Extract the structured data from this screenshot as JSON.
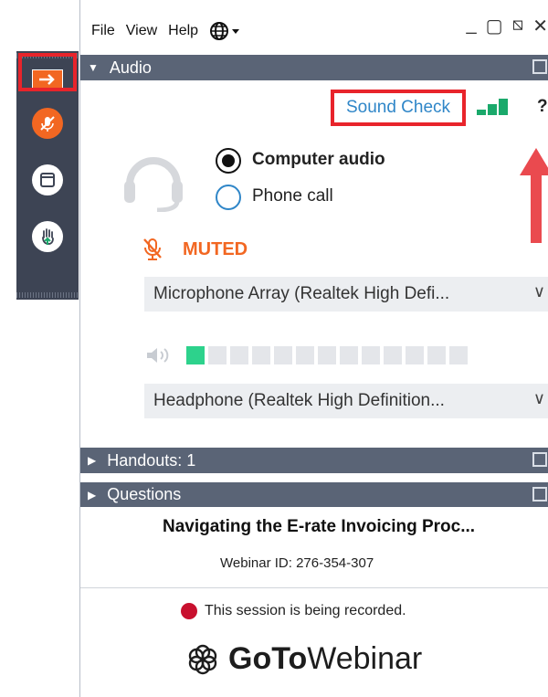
{
  "menu": {
    "items": [
      "File",
      "View",
      "Help"
    ],
    "globe_icon": "globe-icon"
  },
  "window_controls": {
    "minimize": "_",
    "maximize": "▢",
    "restore": "⧅",
    "close": "✕"
  },
  "audio_section": {
    "header": "Audio",
    "sound_check": "Sound Check",
    "help": "?",
    "options": [
      {
        "label": "Computer audio",
        "selected": true
      },
      {
        "label": "Phone call",
        "selected": false
      }
    ],
    "mute_status": "MUTED",
    "microphone": "Microphone Array (Realtek High Defi...",
    "speaker": "Headphone (Realtek High Definition...",
    "speaker_level_segments": 1,
    "speaker_total_segments": 13
  },
  "handouts_section": {
    "header": "Handouts: 1"
  },
  "questions_section": {
    "header": "Questions"
  },
  "webinar": {
    "title": "Navigating the E-rate Invoicing Proc...",
    "id_text": "Webinar ID: 276-354-307",
    "recording_notice": "This session is being recorded.",
    "brand_goto": "GoTo",
    "brand_webinar": "Webinar"
  },
  "colors": {
    "accent_orange": "#f26722",
    "highlight_red": "#e8242b",
    "link_blue": "#2f86c8",
    "meter_green": "#2dd28c",
    "header_gray": "#5a6476"
  }
}
